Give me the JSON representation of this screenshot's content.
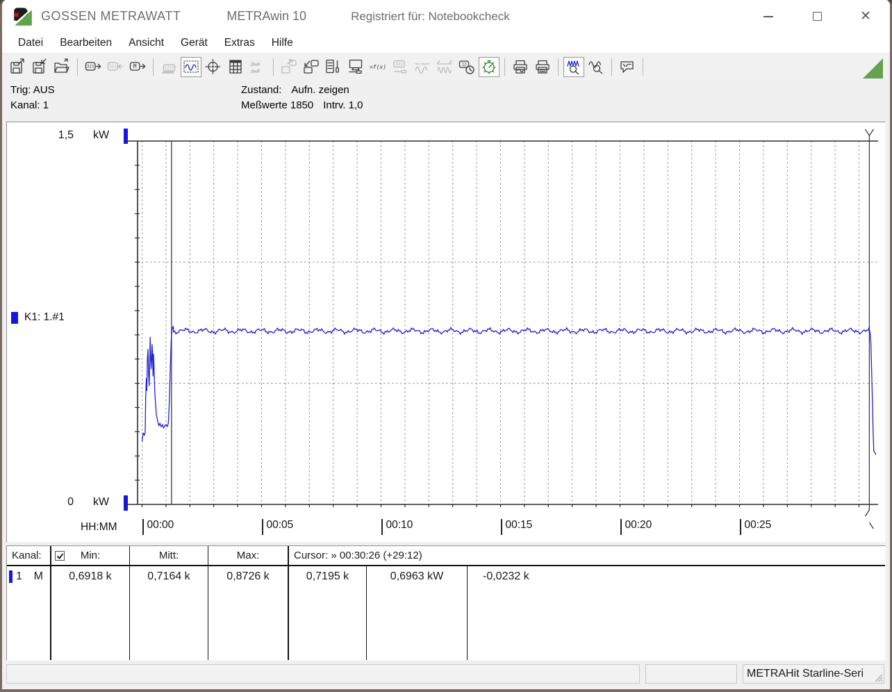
{
  "window": {
    "brand": "GOSSEN METRAWATT",
    "app": "METRAwin 10",
    "registered": "Registriert für: Notebookcheck",
    "controls": [
      "minimize",
      "maximize",
      "close"
    ]
  },
  "menu": {
    "items": [
      "Datei",
      "Bearbeiten",
      "Ansicht",
      "Gerät",
      "Extras",
      "Hilfe"
    ]
  },
  "toolbar": {
    "glyphs": {
      "d321": "321",
      "dm": "M",
      "disp": "1257",
      "fx": "=f(x)",
      "clock12": "12"
    },
    "icons": [
      {
        "name": "file-export-button",
        "state": "normal"
      },
      {
        "name": "file-save-button",
        "state": "normal"
      },
      {
        "name": "file-open-button",
        "state": "normal"
      },
      {
        "name": "read-device-321-button",
        "state": "normal"
      },
      {
        "name": "send-device-321-button",
        "state": "disabled"
      },
      {
        "name": "read-memory-button",
        "state": "normal"
      },
      {
        "name": "show-display-button",
        "state": "disabled"
      },
      {
        "name": "view-trend-button",
        "state": "selected"
      },
      {
        "name": "view-xy-button",
        "state": "normal"
      },
      {
        "name": "view-table-button",
        "state": "normal"
      },
      {
        "name": "view-histogram-button",
        "state": "disabled"
      },
      {
        "name": "save-to-device-button",
        "state": "disabled"
      },
      {
        "name": "load-from-device-button",
        "state": "normal"
      },
      {
        "name": "measurement-settings-button",
        "state": "normal"
      },
      {
        "name": "display-settings-button",
        "state": "normal"
      },
      {
        "name": "formula-button",
        "state": "normal"
      },
      {
        "name": "device-config-button",
        "state": "disabled"
      },
      {
        "name": "analog-wave-button",
        "state": "disabled"
      },
      {
        "name": "multi-wave-button",
        "state": "disabled"
      },
      {
        "name": "time-stamp-button",
        "state": "normal"
      },
      {
        "name": "live-record-button",
        "state": "selected"
      },
      {
        "name": "print-preview-button",
        "state": "normal"
      },
      {
        "name": "print-button",
        "state": "normal"
      },
      {
        "name": "zoom-curve-button",
        "state": "selected"
      },
      {
        "name": "zoom-time-button",
        "state": "normal"
      },
      {
        "name": "comment-button",
        "state": "normal"
      }
    ]
  },
  "info": {
    "trig": "Trig: AUS",
    "kanal": "Kanal: 1",
    "zustand_label": "Zustand:",
    "zustand_value": "Aufn. zeigen",
    "messwerte": "Meßwerte 1850",
    "intervall": "Intrv. 1,0"
  },
  "chart": {
    "y_top": "1,5",
    "y_unit_top": "kW",
    "y_bottom": "0",
    "y_unit_bottom": "kW",
    "x_label": "HH:MM",
    "channel_label": "K1: 1.#1"
  },
  "chart_data": {
    "type": "line",
    "title": "",
    "x_axis": {
      "label": "HH:MM",
      "range_min": [
        0,
        30.8
      ],
      "minor_step_min": 1,
      "major_ticks": [
        {
          "t": 0,
          "label": "00:00"
        },
        {
          "t": 5,
          "label": "00:05"
        },
        {
          "t": 10,
          "label": "00:10"
        },
        {
          "t": 15,
          "label": "00:15"
        },
        {
          "t": 20,
          "label": "00:20"
        },
        {
          "t": 25,
          "label": "00:25"
        }
      ]
    },
    "y_axis": {
      "unit": "kW",
      "range": [
        0,
        1.5
      ],
      "top_tick_label": "1,5",
      "bottom_tick_label": "0",
      "dashed_gridlines": [
        0.5,
        1.0
      ],
      "minor_step": 0.1
    },
    "samples_total": 1850,
    "sample_interval_s": 1.0,
    "series": [
      {
        "name": "K1: 1.#1",
        "color": "#2121cf",
        "stats": {
          "min_kw": 0.6918,
          "mean_kw": 0.7164,
          "max_kw": 0.8726
        },
        "pre_points": [
          [
            0,
            0.26
          ],
          [
            0.05,
            0.295
          ],
          [
            0.1,
            0.285
          ],
          [
            0.13,
            0.3
          ],
          [
            0.15,
            0.44
          ],
          [
            0.18,
            0.52
          ],
          [
            0.2,
            0.47
          ],
          [
            0.22,
            0.6
          ],
          [
            0.25,
            0.64
          ],
          [
            0.27,
            0.54
          ],
          [
            0.3,
            0.49
          ],
          [
            0.32,
            0.58
          ],
          [
            0.34,
            0.69
          ],
          [
            0.36,
            0.61
          ],
          [
            0.38,
            0.56
          ],
          [
            0.4,
            0.6
          ],
          [
            0.42,
            0.66
          ],
          [
            0.44,
            0.62
          ],
          [
            0.46,
            0.53
          ],
          [
            0.48,
            0.62
          ],
          [
            0.5,
            0.57
          ],
          [
            0.53,
            0.47
          ],
          [
            0.56,
            0.42
          ],
          [
            0.6,
            0.37
          ],
          [
            0.65,
            0.345
          ],
          [
            0.7,
            0.325
          ],
          [
            0.75,
            0.335
          ],
          [
            0.8,
            0.32
          ],
          [
            0.85,
            0.33
          ],
          [
            0.9,
            0.315
          ],
          [
            0.95,
            0.325
          ],
          [
            1,
            0.33
          ],
          [
            1.05,
            0.32
          ],
          [
            1.1,
            0.335
          ],
          [
            1.14,
            0.42
          ],
          [
            1.18,
            0.56
          ],
          [
            1.22,
            0.68
          ],
          [
            1.26,
            0.725
          ],
          [
            1.3,
            0.735
          ],
          [
            1.32,
            0.72
          ]
        ],
        "steady": {
          "from_min": 1.32,
          "to_min": 30.45,
          "mean_kw": 0.716,
          "noise_kw": 0.011,
          "sample_step_min": 0.05
        },
        "end_points": [
          [
            30.47,
            0.705
          ],
          [
            30.5,
            0.66
          ],
          [
            30.53,
            0.55
          ],
          [
            30.56,
            0.43
          ],
          [
            30.59,
            0.3
          ],
          [
            30.62,
            0.22
          ],
          [
            30.66,
            0.215
          ],
          [
            30.7,
            0.205
          ]
        ]
      }
    ],
    "cursors": {
      "c1_time_min": 1.233,
      "c2_time_min": 30.433,
      "readout": "Cursor: » 00:30:26 (+29:12)"
    }
  },
  "table": {
    "headers": {
      "kanal": "Kanal:",
      "min": "Min:",
      "mitt": "Mitt:",
      "max": "Max:",
      "cursor": "Cursor: » 00:30:26 (+29:12)"
    },
    "checkbox_checked": true,
    "row": {
      "channel": "1",
      "mode": "M",
      "min": "0,6918 k",
      "mitt": "0,7164 k",
      "max": "0,8726 k",
      "cursor1": "0,7195  k",
      "cursor2": "0,6963  kW",
      "delta": "-0,0232  k"
    }
  },
  "statusbar": {
    "sections": [
      "",
      "",
      "METRAHit Starline-Seri"
    ]
  },
  "colors": {
    "curve_blue": "#2121cf",
    "marker_blue": "#1616e0",
    "brand_green": "#64a24d",
    "frame_brown": "#7b6a61",
    "toolbar_bg": "#f1f1f1"
  }
}
